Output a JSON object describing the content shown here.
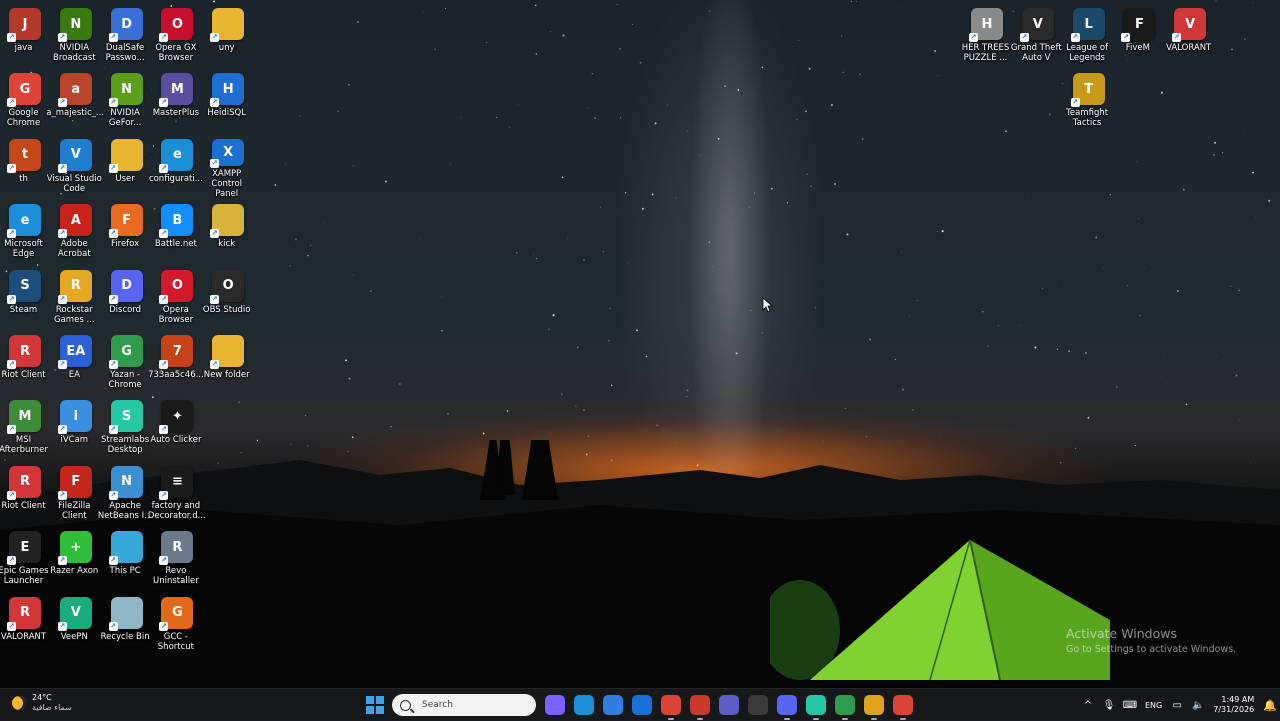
{
  "desktop_icons": [
    {
      "label": "java",
      "glyph": "J",
      "color": "#b33a2b",
      "col": 0,
      "row": 0
    },
    {
      "label": "Google Chrome",
      "glyph": "G",
      "color": "#db4437",
      "col": 0,
      "row": 1
    },
    {
      "label": "th",
      "glyph": "t",
      "color": "#c2481a",
      "col": 0,
      "row": 2
    },
    {
      "label": "Microsoft Edge",
      "glyph": "e",
      "color": "#1a8fd8",
      "col": 0,
      "row": 3
    },
    {
      "label": "Steam",
      "glyph": "S",
      "color": "#1b4e7a",
      "col": 0,
      "row": 4
    },
    {
      "label": "Riot Client",
      "glyph": "R",
      "color": "#d13639",
      "col": 0,
      "row": 5
    },
    {
      "label": "MSI Afterburner",
      "glyph": "M",
      "color": "#3e8c3a",
      "col": 0,
      "row": 6
    },
    {
      "label": "Riot Client",
      "glyph": "R",
      "color": "#d13639",
      "col": 0,
      "row": 7
    },
    {
      "label": "Epic Games Launcher",
      "glyph": "E",
      "color": "#222222",
      "col": 0,
      "row": 8
    },
    {
      "label": "VALORANT",
      "glyph": "R",
      "color": "#d13639",
      "col": 0,
      "row": 9
    },
    {
      "label": "NVIDIA Broadcast",
      "glyph": "N",
      "color": "#3a7a14",
      "col": 1,
      "row": 0
    },
    {
      "label": "a_majestic_...",
      "glyph": "a",
      "color": "#b8442a",
      "col": 1,
      "row": 1
    },
    {
      "label": "Visual Studio Code",
      "glyph": "V",
      "color": "#1e7fd0",
      "col": 1,
      "row": 2
    },
    {
      "label": "Adobe Acrobat",
      "glyph": "A",
      "color": "#c9241c",
      "col": 1,
      "row": 3
    },
    {
      "label": "Rockstar Games ...",
      "glyph": "R",
      "color": "#e5a823",
      "col": 1,
      "row": 4
    },
    {
      "label": "EA",
      "glyph": "EA",
      "color": "#2a5fd6",
      "col": 1,
      "row": 5
    },
    {
      "label": "iVCam",
      "glyph": "i",
      "color": "#3b8fe0",
      "col": 1,
      "row": 6
    },
    {
      "label": "FileZilla Client",
      "glyph": "F",
      "color": "#c4271c",
      "col": 1,
      "row": 7
    },
    {
      "label": "Razer Axon",
      "glyph": "+",
      "color": "#2fbe3a",
      "col": 1,
      "row": 8
    },
    {
      "label": "VeePN",
      "glyph": "V",
      "color": "#1cab7d",
      "col": 1,
      "row": 9
    },
    {
      "label": "DualSafe Passwo...",
      "glyph": "D",
      "color": "#3a6fd8",
      "col": 2,
      "row": 0
    },
    {
      "label": "NVIDIA GeFor...",
      "glyph": "N",
      "color": "#5a9e1a",
      "col": 2,
      "row": 1
    },
    {
      "label": "User",
      "glyph": "",
      "color": "#e8b531",
      "col": 2,
      "row": 2
    },
    {
      "label": "Firefox",
      "glyph": "F",
      "color": "#e76a1f",
      "col": 2,
      "row": 3
    },
    {
      "label": "Discord",
      "glyph": "D",
      "color": "#5865f2",
      "col": 2,
      "row": 4
    },
    {
      "label": "Yazan - Chrome",
      "glyph": "G",
      "color": "#2e9c4c",
      "col": 2,
      "row": 5
    },
    {
      "label": "Streamlabs Desktop",
      "glyph": "S",
      "color": "#25c7a5",
      "col": 2,
      "row": 6
    },
    {
      "label": "Apache NetBeans I...",
      "glyph": "N",
      "color": "#3a8fd0",
      "col": 2,
      "row": 7
    },
    {
      "label": "This PC",
      "glyph": "",
      "color": "#35a7d8",
      "col": 2,
      "row": 8
    },
    {
      "label": "Recycle Bin",
      "glyph": "",
      "color": "#8fb7c7",
      "col": 2,
      "row": 9
    },
    {
      "label": "Opera GX Browser",
      "glyph": "O",
      "color": "#c8102e",
      "col": 3,
      "row": 0
    },
    {
      "label": "MasterPlus",
      "glyph": "M",
      "color": "#5a4ea0",
      "col": 3,
      "row": 1
    },
    {
      "label": "configurati...",
      "glyph": "e",
      "color": "#1a8fd8",
      "col": 3,
      "row": 2
    },
    {
      "label": "Battle.net",
      "glyph": "B",
      "color": "#148eff",
      "col": 3,
      "row": 3
    },
    {
      "label": "Opera Browser",
      "glyph": "O",
      "color": "#d21a2a",
      "col": 3,
      "row": 4
    },
    {
      "label": "733aa5c46...",
      "glyph": "7",
      "color": "#c6431a",
      "col": 3,
      "row": 5
    },
    {
      "label": "Auto Clicker",
      "glyph": "✦",
      "color": "#1a1a1a",
      "col": 3,
      "row": 6
    },
    {
      "label": "factory and Decorator.d...",
      "glyph": "≡",
      "color": "#1a1a1a",
      "col": 3,
      "row": 7
    },
    {
      "label": "Revo Uninstaller",
      "glyph": "R",
      "color": "#6a7a8a",
      "col": 3,
      "row": 8
    },
    {
      "label": "GCC - Shortcut",
      "glyph": "G",
      "color": "#e06a1a",
      "col": 3,
      "row": 9
    },
    {
      "label": "uny",
      "glyph": "",
      "color": "#e8b531",
      "col": 4,
      "row": 0
    },
    {
      "label": "HeidiSQL",
      "glyph": "H",
      "color": "#1e6fd0",
      "col": 4,
      "row": 1
    },
    {
      "label": "XAMPP Control Panel",
      "glyph": "X",
      "color": "#1e6fd0",
      "col": 4,
      "row": 2
    },
    {
      "label": "kick",
      "glyph": "",
      "color": "#d6b33a",
      "col": 4,
      "row": 3
    },
    {
      "label": "OBS Studio",
      "glyph": "O",
      "color": "#2a2a2a",
      "col": 4,
      "row": 4
    },
    {
      "label": "New folder",
      "glyph": "",
      "color": "#e8b531",
      "col": 4,
      "row": 5
    }
  ],
  "desktop_icons_right": [
    {
      "label": "HER TREES PUZZLE ...",
      "glyph": "H",
      "color": "#8a8a8a",
      "col": 0,
      "row": 0
    },
    {
      "label": "Grand Theft Auto V",
      "glyph": "V",
      "color": "#2a2a2a",
      "col": 1,
      "row": 0
    },
    {
      "label": "League of Legends",
      "glyph": "L",
      "color": "#1a4a6a",
      "col": 2,
      "row": 0
    },
    {
      "label": "FiveM",
      "glyph": "F",
      "color": "#1a1a1a",
      "col": 3,
      "row": 0
    },
    {
      "label": "VALORANT",
      "glyph": "V",
      "color": "#d13639",
      "col": 4,
      "row": 0
    },
    {
      "label": "Teamfight Tactics",
      "glyph": "T",
      "color": "#c89a1a",
      "col": 2,
      "row": 1
    }
  ],
  "watermark": {
    "title": "Activate Windows",
    "subtitle": "Go to Settings to activate Windows."
  },
  "taskbar": {
    "weather_temp": "24°C",
    "weather_desc": "سماء صافية",
    "search_placeholder": "Search",
    "apps": [
      {
        "name": "copilot-icon",
        "color": "#7b61ff",
        "running": false
      },
      {
        "name": "edge-icon",
        "color": "#1a8fd8",
        "running": false
      },
      {
        "name": "store-icon",
        "color": "#2f7de1",
        "running": false
      },
      {
        "name": "outlook-icon",
        "color": "#1a6fd8",
        "running": false
      },
      {
        "name": "chrome-icon",
        "color": "#db4437",
        "running": true
      },
      {
        "name": "chrome-profile-icon",
        "color": "#c9382b",
        "running": true
      },
      {
        "name": "teams-icon",
        "color": "#5b5fc7",
        "running": false
      },
      {
        "name": "obs-icon",
        "color": "#3a3a3a",
        "running": false
      },
      {
        "name": "discord-icon",
        "color": "#5865f2",
        "running": true
      },
      {
        "name": "streamlabs-icon",
        "color": "#25c7a5",
        "running": true
      },
      {
        "name": "chrome-icon-2",
        "color": "#2e9c4c",
        "running": true
      },
      {
        "name": "chrome-icon-3",
        "color": "#e0a21a",
        "running": true
      },
      {
        "name": "chrome-icon-4",
        "color": "#db4437",
        "running": true
      }
    ],
    "lang": "ENG",
    "time": "1:49 AM",
    "date": "7/31/2026"
  }
}
